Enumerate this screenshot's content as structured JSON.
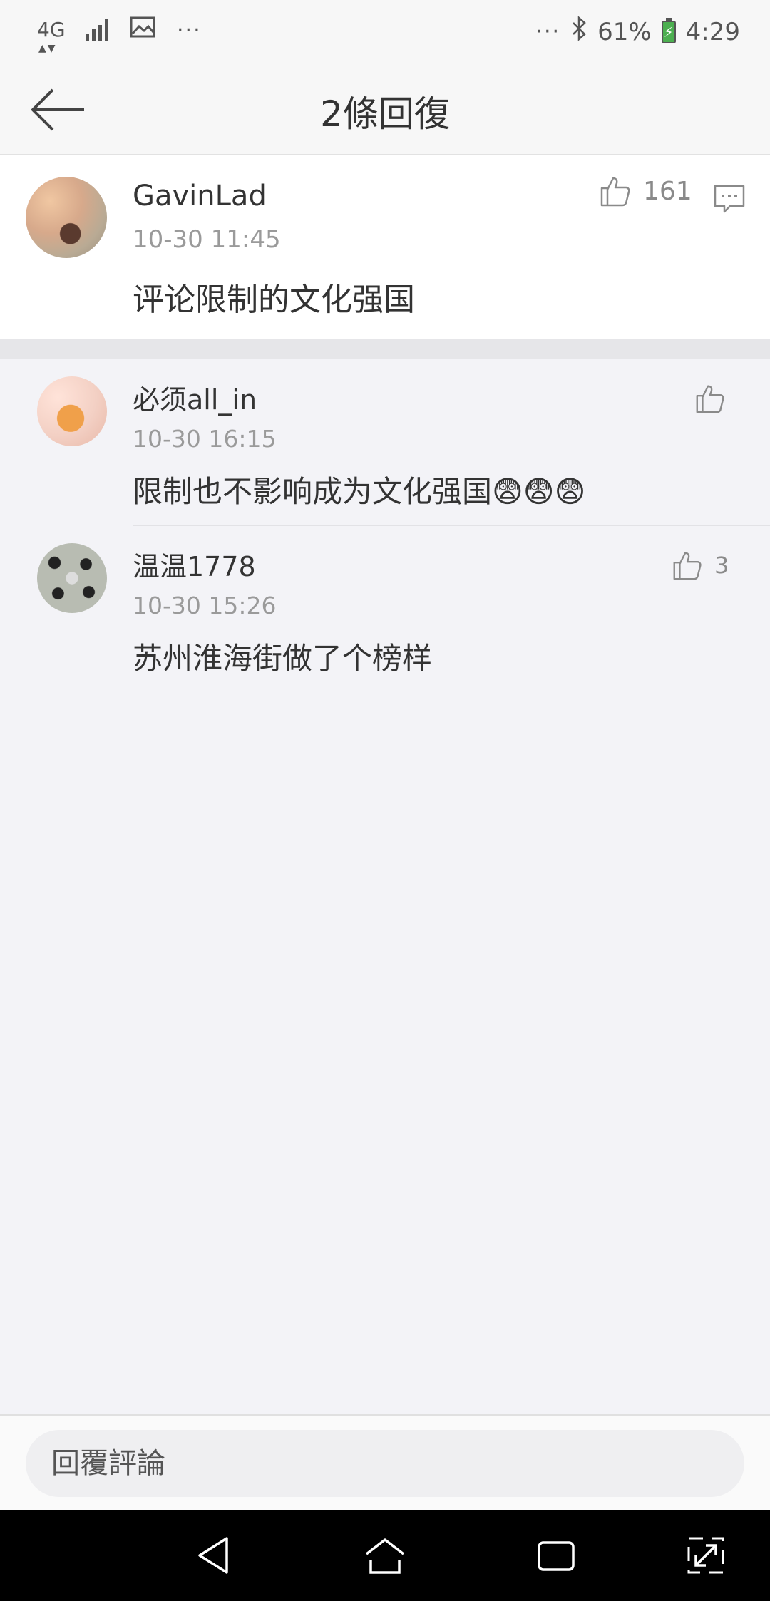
{
  "status_bar": {
    "network": "4G",
    "more_left": "···",
    "more_right": "···",
    "battery_percent": "61%",
    "time": "4:29"
  },
  "header": {
    "title": "2條回復"
  },
  "main_comment": {
    "username": "GavinLad",
    "timestamp": "10-30 11:45",
    "content": "评论限制的文化强国",
    "like_count": "161"
  },
  "replies": [
    {
      "username": "必须all_in",
      "timestamp": "10-30 16:15",
      "content": "限制也不影响成为文化强国😨😨😨",
      "like_count": ""
    },
    {
      "username": "温温1778",
      "timestamp": "10-30 15:26",
      "content": "苏州淮海街做了个榜样",
      "like_count": "3"
    }
  ],
  "reply_bar": {
    "placeholder": "回覆評論"
  },
  "icons": {
    "back": "arrow-left-icon",
    "like": "thumbs-up-icon",
    "comment": "comment-bubble-icon",
    "nav_back": "triangle-back-icon",
    "nav_home": "home-icon",
    "nav_recents": "recents-icon",
    "nav_expand": "expand-icon"
  }
}
